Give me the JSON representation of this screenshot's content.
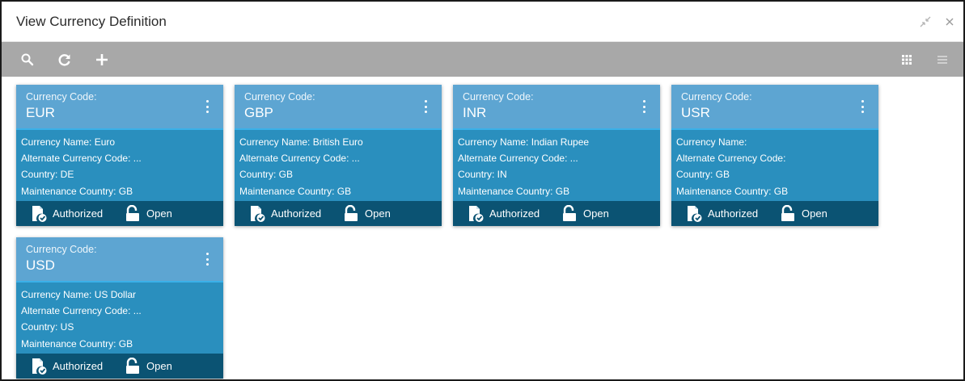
{
  "window": {
    "title": "View Currency Definition",
    "controls": {
      "minimize_icon": "collapse-icon",
      "close_icon": "close-icon"
    }
  },
  "toolbar": {
    "left_icons": [
      "search-icon",
      "refresh-icon",
      "add-icon"
    ],
    "right_icons": [
      "grid-view-icon",
      "list-view-icon"
    ]
  },
  "cards": [
    {
      "code_label": "Currency Code:",
      "code": "EUR",
      "name": "Currency Name: Euro",
      "alternate": "Alternate Currency Code: ...",
      "country": "Country: DE",
      "maintenance": "Maintenance Country: GB",
      "status": "Authorized",
      "record": "Open"
    },
    {
      "code_label": "Currency Code:",
      "code": "GBP",
      "name": "Currency Name: British Euro",
      "alternate": "Alternate Currency Code: ...",
      "country": "Country: GB",
      "maintenance": "Maintenance Country: GB",
      "status": "Authorized",
      "record": "Open"
    },
    {
      "code_label": "Currency Code:",
      "code": "INR",
      "name": "Currency Name: Indian Rupee",
      "alternate": "Alternate Currency Code: ...",
      "country": "Country: IN",
      "maintenance": "Maintenance Country: GB",
      "status": "Authorized",
      "record": "Open"
    },
    {
      "code_label": "Currency Code:",
      "code": "USR",
      "name": "Currency Name:",
      "alternate": "Alternate Currency Code:",
      "country": "Country: GB",
      "maintenance": "Maintenance Country: GB",
      "status": "Authorized",
      "record": "Open"
    },
    {
      "code_label": "Currency Code:",
      "code": "USD",
      "name": "Currency Name: US Dollar",
      "alternate": "Alternate Currency Code: ...",
      "country": "Country: US",
      "maintenance": "Maintenance Country: GB",
      "status": "Authorized",
      "record": "Open"
    }
  ],
  "colors": {
    "card_body": "#2a8fbe",
    "card_header": "#5da5d2",
    "card_footer": "#0b5373",
    "toolbar": "#a8a8a8"
  }
}
